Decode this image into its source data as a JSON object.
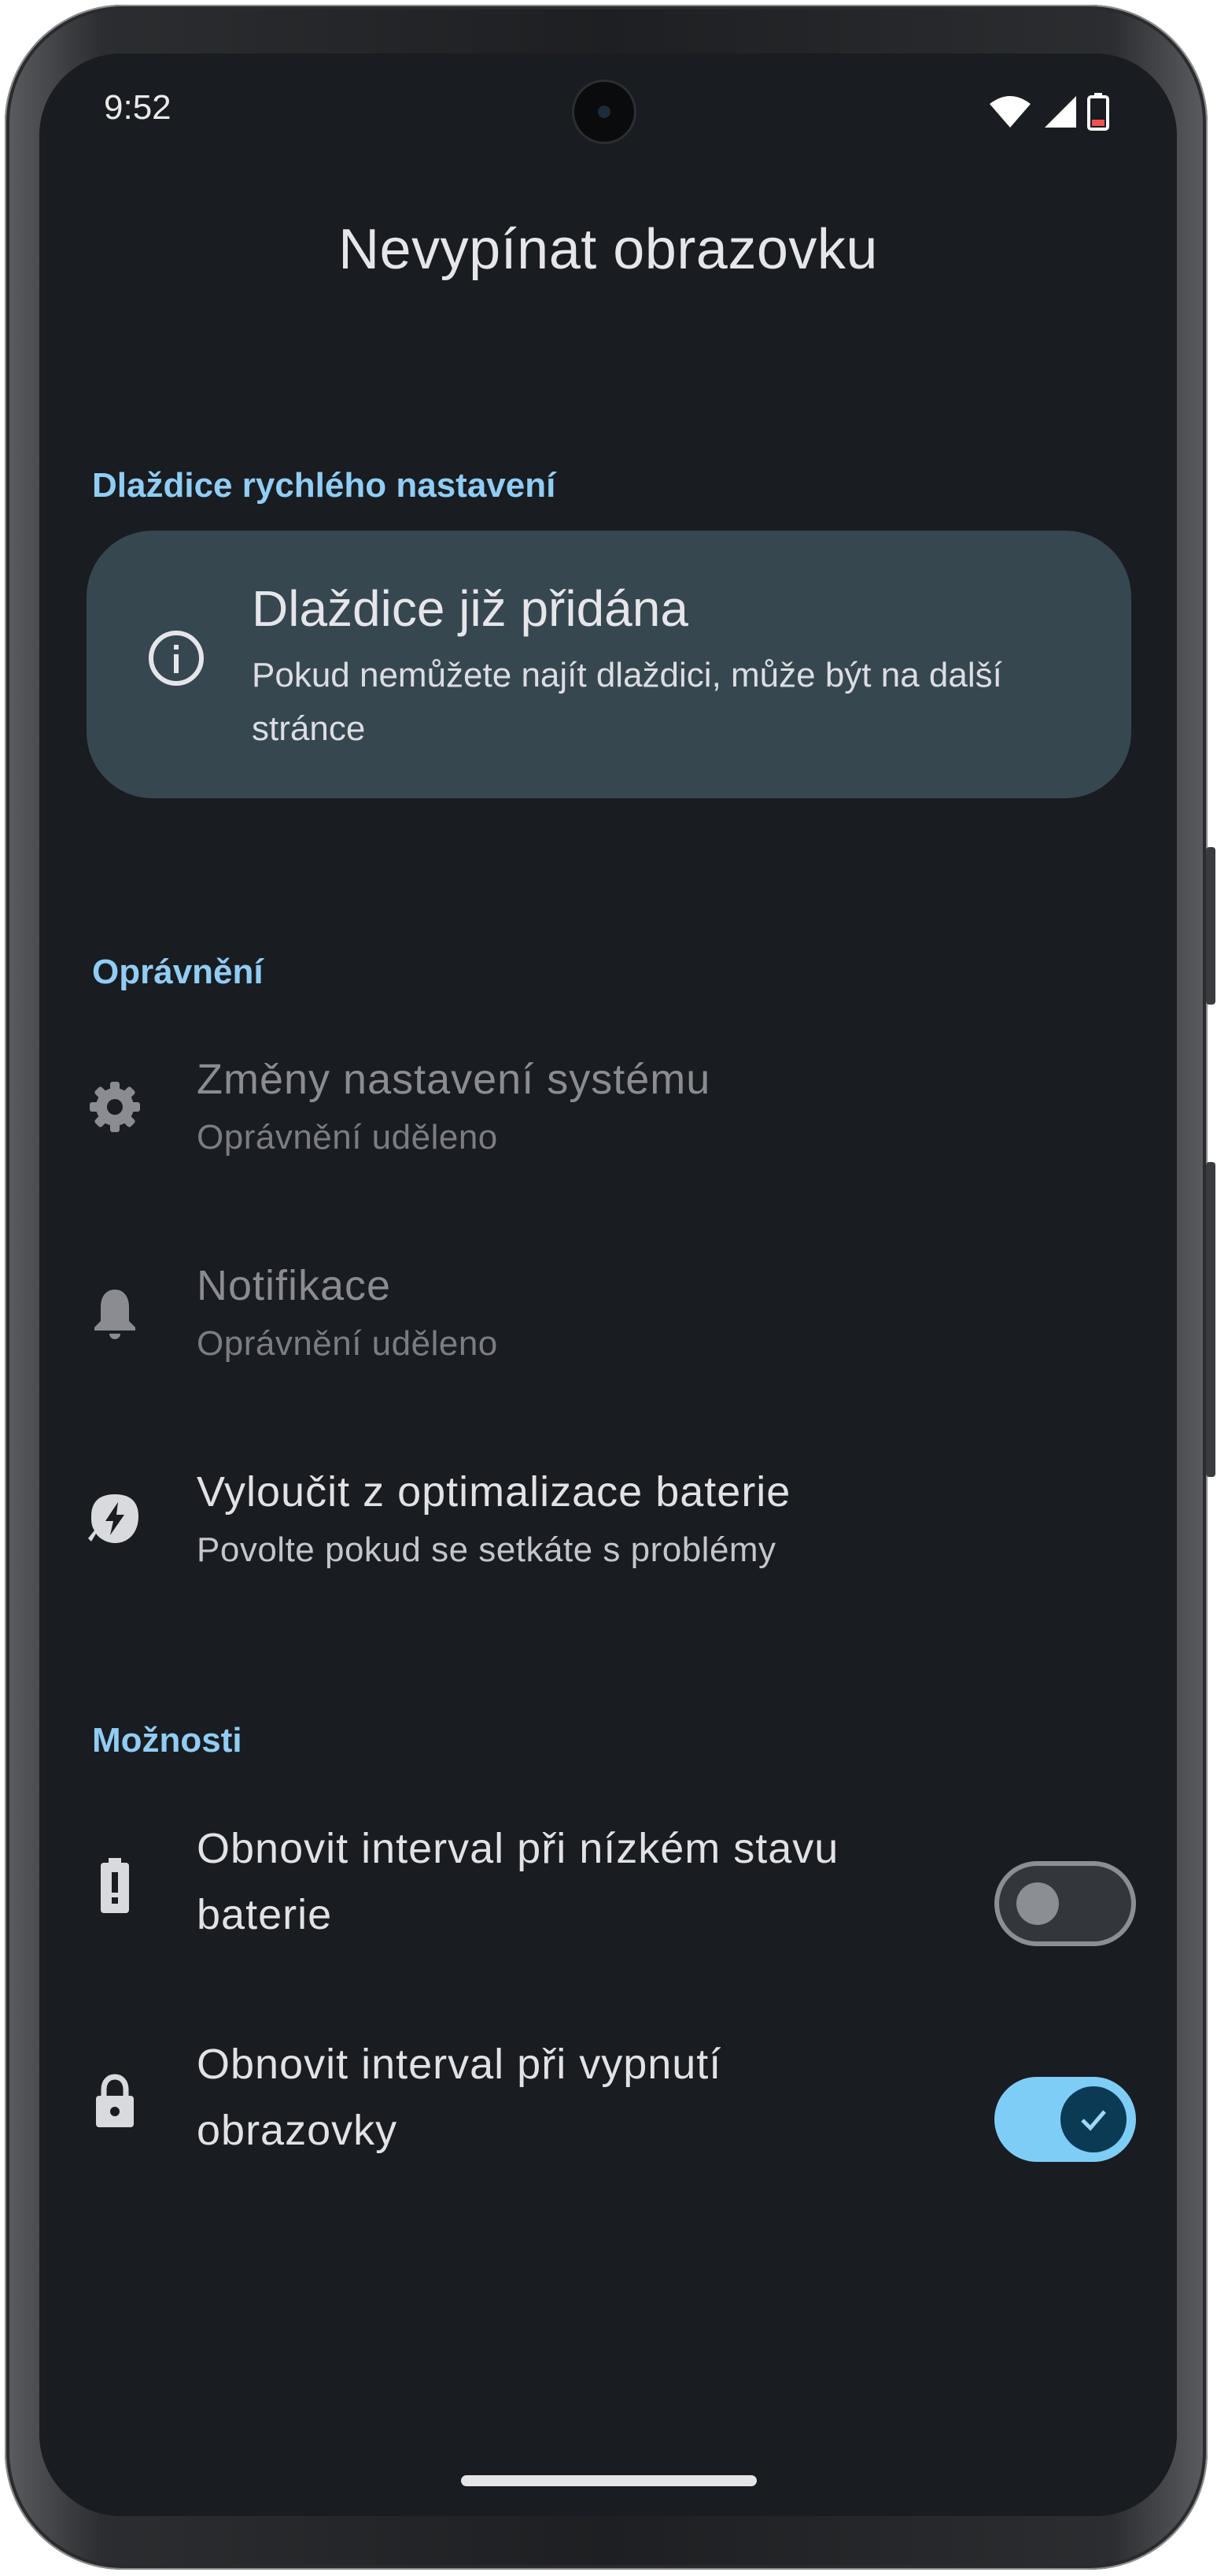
{
  "status_bar": {
    "time": "9:52",
    "icons": [
      "wifi-icon",
      "signal-icon",
      "battery-low-icon"
    ]
  },
  "page": {
    "title": "Nevypínat obrazovku"
  },
  "sections": {
    "quick_settings": "Dlaždice rychlého nastavení",
    "permissions": "Oprávnění",
    "options": "Možnosti"
  },
  "info_card": {
    "icon": "info-icon",
    "title": "Dlaždice již přidána",
    "subtitle": "Pokud nemůžete najít dlaždici, může být na další stránce"
  },
  "permissions": [
    {
      "icon": "gear-icon",
      "title": "Změny nastavení systému",
      "subtitle": "Oprávnění uděleno",
      "granted": true
    },
    {
      "icon": "bell-icon",
      "title": "Notifikace",
      "subtitle": "Oprávnění uděleno",
      "granted": true
    },
    {
      "icon": "battery-saver-icon",
      "title": "Vyloučit z optimalizace baterie",
      "subtitle": "Povolte pokud se setkáte s problémy",
      "granted": false
    }
  ],
  "options": [
    {
      "icon": "battery-alert-icon",
      "title": "Obnovit interval při nízkém stavu baterie",
      "enabled": false
    },
    {
      "icon": "lock-icon",
      "title": "Obnovit interval při vypnutí obrazovky",
      "enabled": true
    }
  ],
  "colors": {
    "background": "#191c20",
    "accent": "#90cdf4",
    "card": "#37474f",
    "switch_on_track": "#7ecdf7",
    "switch_on_thumb": "#0b3a55"
  }
}
